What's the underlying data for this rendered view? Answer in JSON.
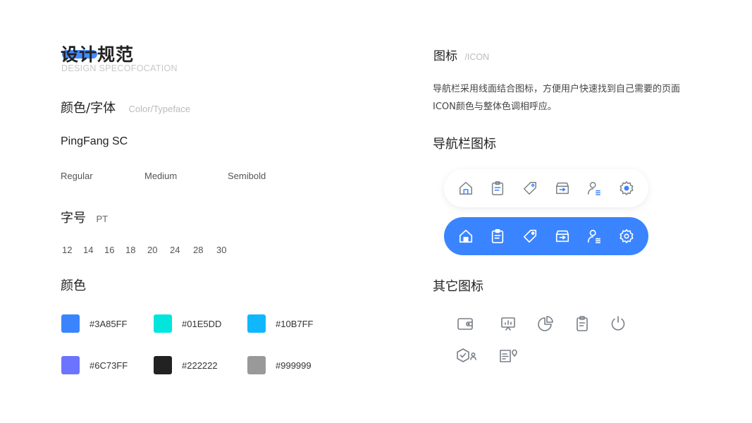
{
  "left": {
    "title": "设计规范",
    "subtitle": "DESIGN SPECOFOCATION",
    "color_font": {
      "title": "颜色/字体",
      "subtitle": "Color/Typeface"
    },
    "font_name": "PingFang SC",
    "weights": [
      "Regular",
      "Medium",
      "Semibold"
    ],
    "font_size": {
      "title": "字号",
      "unit": "PT",
      "sizes": [
        "12",
        "14",
        "16",
        "18",
        "20",
        "24",
        "28",
        "30"
      ]
    },
    "colors_title": "颜色",
    "swatches": [
      {
        "hex": "#3A85FF",
        "label": "#3A85FF"
      },
      {
        "hex": "#01E5DD",
        "label": "#01E5DD"
      },
      {
        "hex": "#10B7FF",
        "label": "#10B7FF"
      },
      {
        "hex": "#6C73FF",
        "label": "#6C73FF"
      },
      {
        "hex": "#222222",
        "label": "#222222"
      },
      {
        "hex": "#999999",
        "label": "#999999"
      }
    ]
  },
  "right": {
    "icon_title": "图标",
    "icon_subtitle": "/ICON",
    "description_line1": "导航栏采用线面结合图标，方便用户快速找到自己需要的页面",
    "description_line2": "ICON颜色与整体色调相呼应。",
    "nav_title": "导航栏图标",
    "nav_icons": [
      "home-icon",
      "clipboard-icon",
      "tag-icon",
      "inbox-icon",
      "user-list-icon",
      "settings-icon"
    ],
    "other_title": "其它图标",
    "other_icons": [
      "wallet-icon",
      "presentation-icon",
      "pie-chart-icon",
      "clipboard-icon",
      "power-icon",
      "shield-user-icon",
      "document-location-icon"
    ]
  },
  "colors": {
    "accent": "#3A85FF",
    "icon_gray": "#7a7f87",
    "icon_active": "#3A85FF"
  }
}
